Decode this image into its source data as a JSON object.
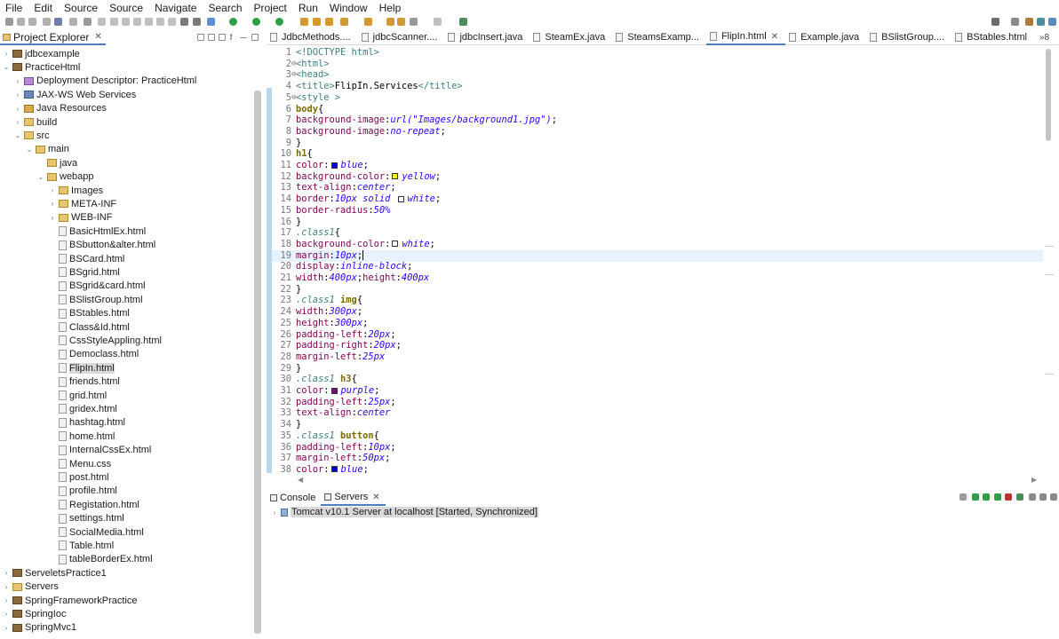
{
  "menubar": [
    "File",
    "Edit",
    "Source",
    "Source",
    "Navigate",
    "Search",
    "Project",
    "Run",
    "Window",
    "Help"
  ],
  "explorer": {
    "title": "Project Explorer",
    "close_glyph": "✕",
    "items": [
      {
        "label": "jdbcexample",
        "icon": "project-icon",
        "arrow": "›"
      },
      {
        "label": "PracticeHtml",
        "icon": "project-icon",
        "arrow": "⌄"
      },
      {
        "label": "Deployment Descriptor: PracticeHtml",
        "icon": "deployment-descriptor-icon",
        "arrow": "›"
      },
      {
        "label": "JAX-WS Web Services",
        "icon": "web-services-icon",
        "arrow": "›"
      },
      {
        "label": "Java Resources",
        "icon": "java-resources-icon",
        "arrow": "›"
      },
      {
        "label": "build",
        "icon": "folder-icon",
        "arrow": "›"
      },
      {
        "label": "src",
        "icon": "folder-icon",
        "arrow": "⌄"
      },
      {
        "label": "main",
        "icon": "folder-icon",
        "arrow": "⌄"
      },
      {
        "label": "java",
        "icon": "folder-icon",
        "arrow": ""
      },
      {
        "label": "webapp",
        "icon": "folder-icon",
        "arrow": "⌄"
      },
      {
        "label": "Images",
        "icon": "folder-icon",
        "arrow": "›"
      },
      {
        "label": "META-INF",
        "icon": "folder-icon",
        "arrow": "›"
      },
      {
        "label": "WEB-INF",
        "icon": "folder-icon",
        "arrow": "›"
      },
      {
        "label": "BasicHtmlEx.html",
        "icon": "html-file-icon",
        "arrow": ""
      },
      {
        "label": "BSbutton&alter.html",
        "icon": "html-file-icon",
        "arrow": ""
      },
      {
        "label": "BSCard.html",
        "icon": "html-file-icon",
        "arrow": ""
      },
      {
        "label": "BSgrid.html",
        "icon": "html-file-icon",
        "arrow": ""
      },
      {
        "label": "BSgrid&card.html",
        "icon": "html-file-icon",
        "arrow": ""
      },
      {
        "label": "BSlistGroup.html",
        "icon": "html-file-icon",
        "arrow": ""
      },
      {
        "label": "BStables.html",
        "icon": "html-file-icon",
        "arrow": ""
      },
      {
        "label": "Class&Id.html",
        "icon": "html-file-icon",
        "arrow": ""
      },
      {
        "label": "CssStyleAppling.html",
        "icon": "html-file-icon",
        "arrow": ""
      },
      {
        "label": "Democlass.html",
        "icon": "html-file-icon",
        "arrow": ""
      },
      {
        "label": "FlipIn.html",
        "icon": "html-file-icon",
        "arrow": "",
        "selected": true
      },
      {
        "label": "friends.html",
        "icon": "html-file-icon",
        "arrow": ""
      },
      {
        "label": "grid.html",
        "icon": "html-file-icon",
        "arrow": ""
      },
      {
        "label": "gridex.html",
        "icon": "html-file-icon",
        "arrow": ""
      },
      {
        "label": "hashtag.html",
        "icon": "html-file-icon",
        "arrow": ""
      },
      {
        "label": "home.html",
        "icon": "html-file-icon",
        "arrow": ""
      },
      {
        "label": "InternalCssEx.html",
        "icon": "html-file-icon",
        "arrow": ""
      },
      {
        "label": "Menu.css",
        "icon": "css-file-icon",
        "arrow": ""
      },
      {
        "label": "post.html",
        "icon": "html-file-icon",
        "arrow": ""
      },
      {
        "label": "profile.html",
        "icon": "html-file-icon",
        "arrow": ""
      },
      {
        "label": "Registation.html",
        "icon": "html-file-icon",
        "arrow": ""
      },
      {
        "label": "settings.html",
        "icon": "html-file-icon",
        "arrow": ""
      },
      {
        "label": "SocialMedia.html",
        "icon": "html-file-icon",
        "arrow": ""
      },
      {
        "label": "Table.html",
        "icon": "html-file-icon",
        "arrow": ""
      },
      {
        "label": "tableBorderEx.html",
        "icon": "html-file-icon",
        "arrow": ""
      },
      {
        "label": "ServeletsPractice1",
        "icon": "project-icon",
        "arrow": "›"
      },
      {
        "label": "Servers",
        "icon": "folder-icon",
        "arrow": "›"
      },
      {
        "label": "SpringFrameworkPractice",
        "icon": "project-icon",
        "arrow": "›"
      },
      {
        "label": "SpringIoc",
        "icon": "project-icon",
        "arrow": "›"
      },
      {
        "label": "SpringMvc1",
        "icon": "project-icon",
        "arrow": "›"
      }
    ]
  },
  "editor": {
    "tabs": [
      {
        "label": "JdbcMethods....",
        "active": false
      },
      {
        "label": "jdbcScanner....",
        "active": false
      },
      {
        "label": "jdbcInsert.java",
        "active": false
      },
      {
        "label": "SteamEx.java",
        "active": false
      },
      {
        "label": "SteamsExamp...",
        "active": false
      },
      {
        "label": "FlipIn.html",
        "active": true,
        "close": "✕"
      },
      {
        "label": "Example.java",
        "active": false
      },
      {
        "label": "BSlistGroup....",
        "active": false
      },
      {
        "label": "BStables.html",
        "active": false
      }
    ],
    "overflow_label": "»8",
    "current_line": 19,
    "lines": [
      {
        "n": "1",
        "parts": [
          {
            "c": "tag",
            "t": "<!DOCTYPE html>"
          }
        ]
      },
      {
        "n": "2",
        "fold": "⊖",
        "parts": [
          {
            "c": "tag",
            "t": "<html>"
          }
        ]
      },
      {
        "n": "3",
        "fold": "⊖",
        "parts": [
          {
            "c": "tag",
            "t": "<head>"
          }
        ]
      },
      {
        "n": "4",
        "parts": [
          {
            "c": "tag",
            "t": "<title>"
          },
          {
            "c": "plain",
            "t": "FlipIn.Services"
          },
          {
            "c": "tag",
            "t": "</title>"
          }
        ]
      },
      {
        "n": "5",
        "fold": "⊖",
        "parts": [
          {
            "c": "tag",
            "t": "<style >"
          }
        ]
      },
      {
        "n": "6",
        "parts": [
          {
            "c": "sel",
            "t": "body"
          },
          {
            "c": "plain",
            "t": "{"
          }
        ]
      },
      {
        "n": "7",
        "parts": [
          {
            "c": "prop",
            "t": "background-image"
          },
          {
            "c": "plain",
            "t": ":"
          },
          {
            "c": "val",
            "t": "url(\"Images/background1.jpg\")"
          },
          {
            "c": "plain",
            "t": ";"
          }
        ]
      },
      {
        "n": "8",
        "parts": [
          {
            "c": "prop",
            "t": "background-image"
          },
          {
            "c": "plain",
            "t": ":"
          },
          {
            "c": "val",
            "t": "no-repeat"
          },
          {
            "c": "plain",
            "t": ";"
          }
        ]
      },
      {
        "n": "9",
        "parts": [
          {
            "c": "plain",
            "t": "}"
          }
        ]
      },
      {
        "n": "10",
        "parts": [
          {
            "c": "sel",
            "t": "h1"
          },
          {
            "c": "plain",
            "t": "{"
          }
        ]
      },
      {
        "n": "11",
        "parts": [
          {
            "c": "prop",
            "t": "color"
          },
          {
            "c": "plain",
            "t": ":"
          },
          {
            "c": "swatch",
            "color": "#0000cc"
          },
          {
            "c": "val",
            "t": "blue"
          },
          {
            "c": "plain",
            "t": ";"
          }
        ]
      },
      {
        "n": "12",
        "parts": [
          {
            "c": "prop",
            "t": "background-color"
          },
          {
            "c": "plain",
            "t": ":"
          },
          {
            "c": "swatch",
            "color": "#ffff00"
          },
          {
            "c": "val",
            "t": "yellow"
          },
          {
            "c": "plain",
            "t": ";"
          }
        ]
      },
      {
        "n": "13",
        "parts": [
          {
            "c": "prop",
            "t": "text-align"
          },
          {
            "c": "plain",
            "t": ":"
          },
          {
            "c": "val",
            "t": "center"
          },
          {
            "c": "plain",
            "t": ";"
          }
        ]
      },
      {
        "n": "14",
        "parts": [
          {
            "c": "prop",
            "t": "border"
          },
          {
            "c": "plain",
            "t": ":"
          },
          {
            "c": "val",
            "t": "10px solid "
          },
          {
            "c": "swatch",
            "color": "#ffffff"
          },
          {
            "c": "val",
            "t": "white"
          },
          {
            "c": "plain",
            "t": ";"
          }
        ]
      },
      {
        "n": "15",
        "parts": [
          {
            "c": "prop",
            "t": "border-radius"
          },
          {
            "c": "plain",
            "t": ":"
          },
          {
            "c": "val",
            "t": "50%"
          }
        ]
      },
      {
        "n": "16",
        "parts": [
          {
            "c": "plain",
            "t": "}"
          }
        ]
      },
      {
        "n": "17",
        "parts": [
          {
            "c": "selit",
            "t": ".class1"
          },
          {
            "c": "plain",
            "t": "{"
          }
        ]
      },
      {
        "n": "18",
        "parts": [
          {
            "c": "prop",
            "t": "background-color"
          },
          {
            "c": "plain",
            "t": ":"
          },
          {
            "c": "swatch",
            "color": "#ffffff"
          },
          {
            "c": "val",
            "t": "white"
          },
          {
            "c": "plain",
            "t": ";"
          }
        ]
      },
      {
        "n": "19",
        "parts": [
          {
            "c": "prop",
            "t": "margin"
          },
          {
            "c": "plain",
            "t": ":"
          },
          {
            "c": "val",
            "t": "10px"
          },
          {
            "c": "plain",
            "t": ";"
          },
          {
            "c": "caret"
          }
        ]
      },
      {
        "n": "20",
        "parts": [
          {
            "c": "prop",
            "t": "display"
          },
          {
            "c": "plain",
            "t": ":"
          },
          {
            "c": "val",
            "t": "inline-block"
          },
          {
            "c": "plain",
            "t": ";"
          }
        ]
      },
      {
        "n": "21",
        "parts": [
          {
            "c": "prop",
            "t": "width"
          },
          {
            "c": "plain",
            "t": ":"
          },
          {
            "c": "val",
            "t": "400px"
          },
          {
            "c": "plain",
            "t": ";"
          },
          {
            "c": "prop",
            "t": "height"
          },
          {
            "c": "plain",
            "t": ":"
          },
          {
            "c": "val",
            "t": "400px"
          }
        ]
      },
      {
        "n": "22",
        "parts": [
          {
            "c": "plain",
            "t": "}"
          }
        ]
      },
      {
        "n": "23",
        "parts": [
          {
            "c": "selit",
            "t": ".class1 "
          },
          {
            "c": "sel",
            "t": "img"
          },
          {
            "c": "plain",
            "t": "{"
          }
        ]
      },
      {
        "n": "24",
        "parts": [
          {
            "c": "prop",
            "t": "width"
          },
          {
            "c": "plain",
            "t": ":"
          },
          {
            "c": "val",
            "t": "300px"
          },
          {
            "c": "plain",
            "t": ";"
          }
        ]
      },
      {
        "n": "25",
        "parts": [
          {
            "c": "prop",
            "t": "height"
          },
          {
            "c": "plain",
            "t": ":"
          },
          {
            "c": "val",
            "t": "300px"
          },
          {
            "c": "plain",
            "t": ";"
          }
        ]
      },
      {
        "n": "26",
        "parts": [
          {
            "c": "prop",
            "t": "padding-left"
          },
          {
            "c": "plain",
            "t": ":"
          },
          {
            "c": "val",
            "t": "20px"
          },
          {
            "c": "plain",
            "t": ";"
          }
        ]
      },
      {
        "n": "27",
        "parts": [
          {
            "c": "prop",
            "t": "padding-right"
          },
          {
            "c": "plain",
            "t": ":"
          },
          {
            "c": "val",
            "t": "20px"
          },
          {
            "c": "plain",
            "t": ";"
          }
        ]
      },
      {
        "n": "28",
        "parts": [
          {
            "c": "prop",
            "t": "margin-left"
          },
          {
            "c": "plain",
            "t": ":"
          },
          {
            "c": "val",
            "t": "25px"
          }
        ]
      },
      {
        "n": "29",
        "parts": [
          {
            "c": "plain",
            "t": "}"
          }
        ]
      },
      {
        "n": "30",
        "parts": [
          {
            "c": "selit",
            "t": ".class1 "
          },
          {
            "c": "sel",
            "t": "h3"
          },
          {
            "c": "plain",
            "t": "{"
          }
        ]
      },
      {
        "n": "31",
        "parts": [
          {
            "c": "prop",
            "t": "color"
          },
          {
            "c": "plain",
            "t": ":"
          },
          {
            "c": "swatch",
            "color": "#800080"
          },
          {
            "c": "val",
            "t": "purple"
          },
          {
            "c": "plain",
            "t": ";"
          }
        ]
      },
      {
        "n": "32",
        "parts": [
          {
            "c": "prop",
            "t": "padding-left"
          },
          {
            "c": "plain",
            "t": ":"
          },
          {
            "c": "val",
            "t": "25px"
          },
          {
            "c": "plain",
            "t": ";"
          }
        ]
      },
      {
        "n": "33",
        "parts": [
          {
            "c": "prop",
            "t": "text-align"
          },
          {
            "c": "plain",
            "t": ":"
          },
          {
            "c": "val",
            "t": "center"
          }
        ]
      },
      {
        "n": "34",
        "parts": [
          {
            "c": "plain",
            "t": "}"
          }
        ]
      },
      {
        "n": "35",
        "parts": [
          {
            "c": "selit",
            "t": ".class1 "
          },
          {
            "c": "sel",
            "t": "button"
          },
          {
            "c": "plain",
            "t": "{"
          }
        ]
      },
      {
        "n": "36",
        "parts": [
          {
            "c": "prop",
            "t": "padding-left"
          },
          {
            "c": "plain",
            "t": ":"
          },
          {
            "c": "val",
            "t": "10px"
          },
          {
            "c": "plain",
            "t": ";"
          }
        ]
      },
      {
        "n": "37",
        "parts": [
          {
            "c": "prop",
            "t": "margin-left"
          },
          {
            "c": "plain",
            "t": ":"
          },
          {
            "c": "val",
            "t": "50px"
          },
          {
            "c": "plain",
            "t": ";"
          }
        ]
      },
      {
        "n": "38",
        "parts": [
          {
            "c": "prop",
            "t": "color"
          },
          {
            "c": "plain",
            "t": ":"
          },
          {
            "c": "swatch",
            "color": "#0000cc"
          },
          {
            "c": "val",
            "t": "blue"
          },
          {
            "c": "plain",
            "t": ";"
          }
        ]
      }
    ]
  },
  "bottom": {
    "tabs": [
      {
        "label": "Console",
        "active": false,
        "icon": "console-icon"
      },
      {
        "label": "Servers",
        "active": true,
        "icon": "servers-icon",
        "close": "✕"
      }
    ],
    "server_arrow": "›",
    "server_label": "Tomcat v10.1 Server at localhost  [Started, Synchronized]"
  },
  "colors": {
    "accent": "#4a7fc0",
    "selection": "#d9d9d9",
    "current_line": "#e8f2fe"
  }
}
